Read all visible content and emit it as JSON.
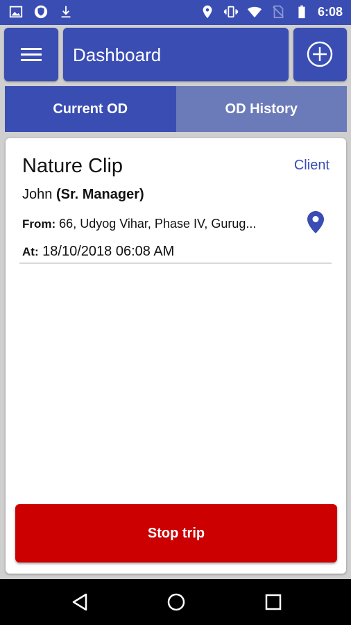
{
  "status_bar": {
    "left_icons": [
      "image-icon",
      "shield-icon",
      "download-icon"
    ],
    "right_icons": [
      "location-icon",
      "vibrate-icon",
      "wifi-icon",
      "no-sim-icon",
      "battery-icon"
    ],
    "time": "6:08"
  },
  "header": {
    "menu_icon": "hamburger-menu-icon",
    "title": "Dashboard",
    "add_icon": "add-circle-icon"
  },
  "tabs": [
    {
      "label": "Current OD",
      "active": true
    },
    {
      "label": "OD History",
      "active": false
    }
  ],
  "od_card": {
    "name": "Nature Clip",
    "type": "Client",
    "person_name": "John ",
    "person_role": "(Sr. Manager)",
    "from_label": "From:",
    "from_value": " 66, Udyog Vihar, Phase IV, Gurug...",
    "at_label": "At:",
    "at_value": " 18/10/2018 06:08 AM",
    "location_icon": "map-pin-icon"
  },
  "actions": {
    "stop_trip_label": "Stop trip"
  },
  "navigation_bar": {
    "icons": [
      "back-icon",
      "home-icon",
      "recents-icon"
    ]
  },
  "colors": {
    "primary": "#3a4db3",
    "tab_inactive": "#6b7ab8",
    "danger": "#cc0000",
    "background": "#cfcfcf"
  }
}
